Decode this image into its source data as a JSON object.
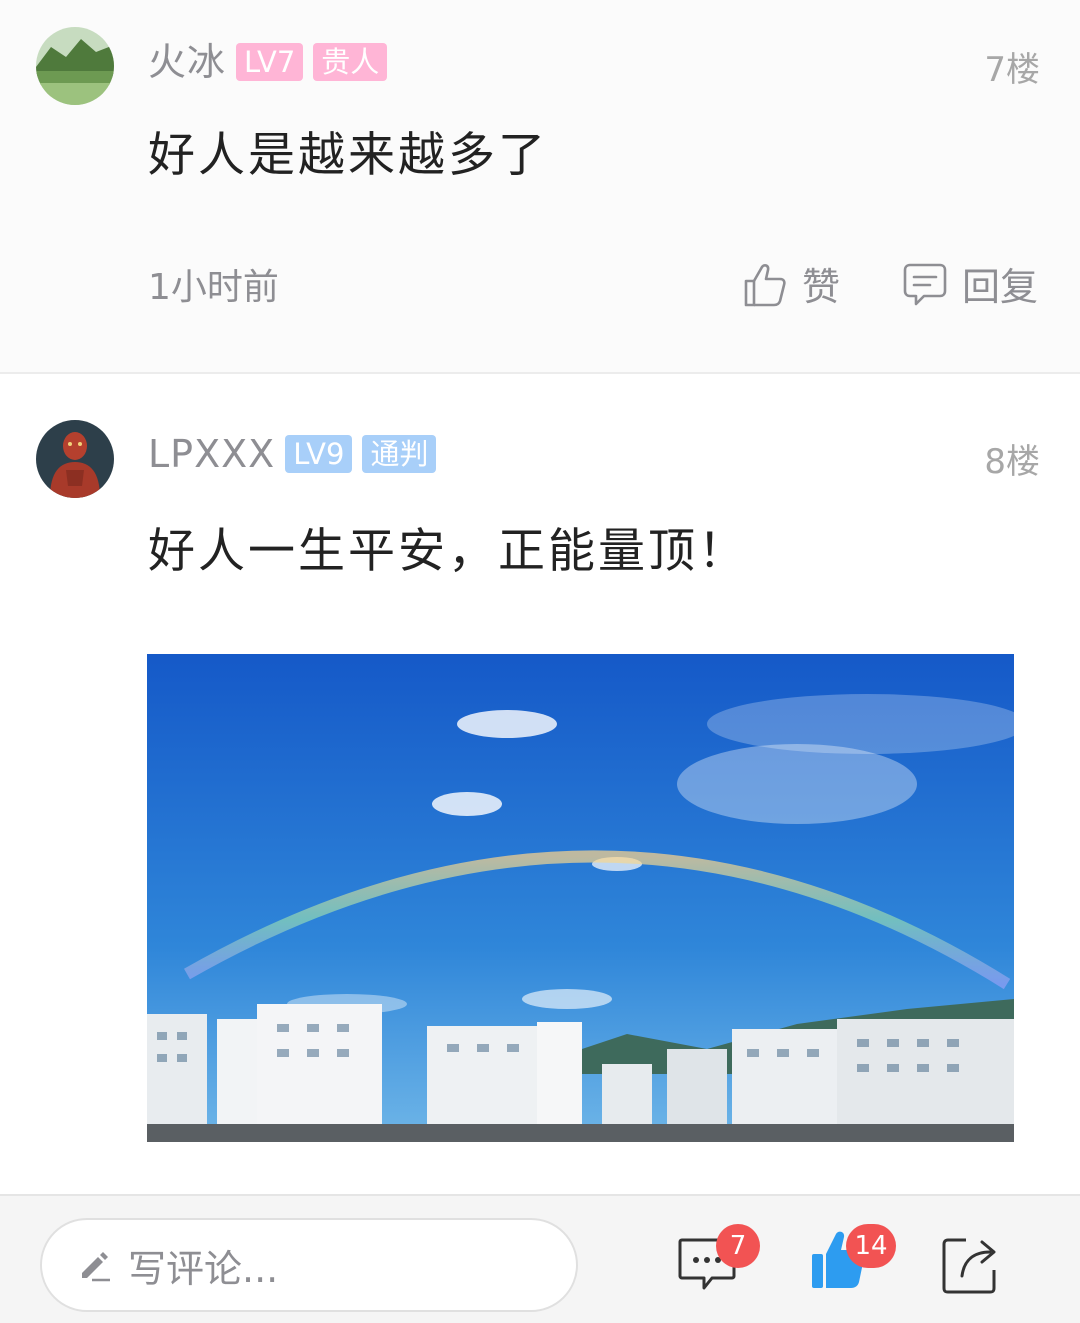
{
  "comments": [
    {
      "username": "火冰",
      "level": "LV7",
      "title_badge": "贵人",
      "floor": "7楼",
      "content": "好人是越来越多了",
      "time": "1小时前",
      "like_label": "赞",
      "reply_label": "回复"
    },
    {
      "username": "LPXXX",
      "level": "LV9",
      "title_badge": "通判",
      "floor": "8楼",
      "content": "好人一生平安，正能量顶！"
    }
  ],
  "bottom_bar": {
    "comment_placeholder": "写评论...",
    "comment_count": "7",
    "like_count": "14"
  },
  "colors": {
    "lv7_badge": "#ffb5d6",
    "lv9_badge": "#a8cff9",
    "count_badge": "#f25353",
    "like_blue": "#2d9cf0"
  },
  "icons": [
    "pencil-icon",
    "comment-icon",
    "thumbs-up-icon",
    "share-icon"
  ]
}
